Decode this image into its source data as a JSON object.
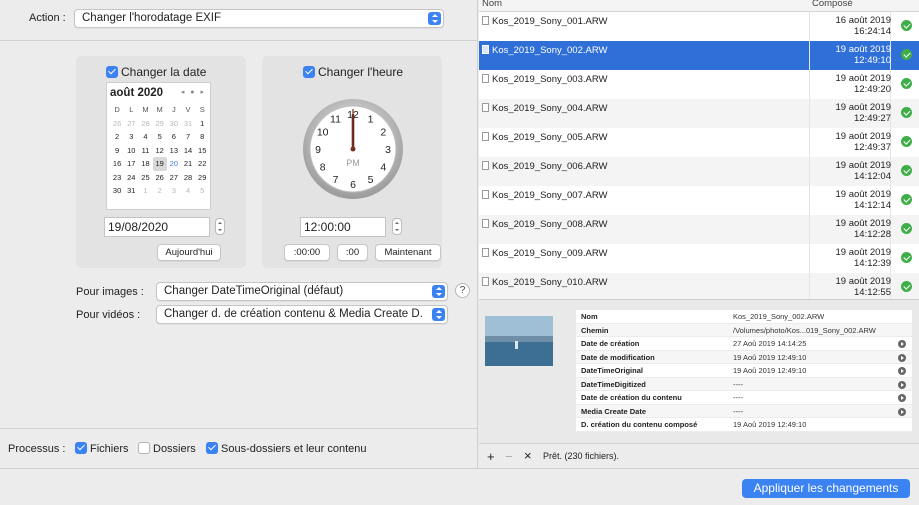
{
  "action": {
    "label": "Action :",
    "value": "Changer l'horodatage EXIF"
  },
  "date_panel": {
    "checkbox_label": "Changer la date",
    "calendar_title": "août 2020",
    "nav": "◂ ● ▸",
    "weekdays": [
      "D",
      "L",
      "M",
      "M",
      "J",
      "V",
      "S"
    ],
    "rows": [
      [
        [
          "26",
          "o"
        ],
        [
          "27",
          "o"
        ],
        [
          "28",
          "o"
        ],
        [
          "29",
          "o"
        ],
        [
          "30",
          "o"
        ],
        [
          "31",
          "o"
        ],
        [
          "1",
          ""
        ]
      ],
      [
        [
          "2",
          ""
        ],
        [
          "3",
          ""
        ],
        [
          "4",
          ""
        ],
        [
          "5",
          ""
        ],
        [
          "6",
          ""
        ],
        [
          "7",
          ""
        ],
        [
          "8",
          ""
        ]
      ],
      [
        [
          "9",
          ""
        ],
        [
          "10",
          ""
        ],
        [
          "11",
          ""
        ],
        [
          "12",
          ""
        ],
        [
          "13",
          ""
        ],
        [
          "14",
          ""
        ],
        [
          "15",
          ""
        ]
      ],
      [
        [
          "16",
          ""
        ],
        [
          "17",
          ""
        ],
        [
          "18",
          ""
        ],
        [
          "19",
          "sel"
        ],
        [
          "20",
          "today"
        ],
        [
          "21",
          ""
        ],
        [
          "22",
          ""
        ]
      ],
      [
        [
          "23",
          ""
        ],
        [
          "24",
          ""
        ],
        [
          "25",
          ""
        ],
        [
          "26",
          ""
        ],
        [
          "27",
          ""
        ],
        [
          "28",
          ""
        ],
        [
          "29",
          ""
        ]
      ],
      [
        [
          "30",
          ""
        ],
        [
          "31",
          ""
        ],
        [
          "1",
          "o"
        ],
        [
          "2",
          "o"
        ],
        [
          "3",
          "o"
        ],
        [
          "4",
          "o"
        ],
        [
          "5",
          "o"
        ]
      ]
    ],
    "date_value": "19/08/2020",
    "today_button": "Aujourd'hui"
  },
  "time_panel": {
    "checkbox_label": "Changer l'heure",
    "clock_numbers": [
      "12",
      "1",
      "2",
      "3",
      "4",
      "5",
      "6",
      "7",
      "8",
      "9",
      "10",
      "11"
    ],
    "clock_period": "PM",
    "time_value": "12:00:00",
    "btn_zero_min": ":00:00",
    "btn_zero_sec": ":00",
    "btn_now": "Maintenant"
  },
  "images": {
    "label": "Pour images :",
    "value": "Changer DateTimeOriginal (défaut)",
    "help": "?"
  },
  "videos": {
    "label": "Pour vidéos :",
    "value": "Changer d. de création contenu & Media Create D."
  },
  "process": {
    "label": "Processus :",
    "files": "Fichiers",
    "folders": "Dossiers",
    "subfolders": "Sous-dossiers et leur contenu"
  },
  "table": {
    "col_name": "Nom",
    "col_composed": "Composé",
    "rows": [
      {
        "name": "Kos_2019_Sony_001.ARW",
        "date": "16 août 2019",
        "time": "16:24:14"
      },
      {
        "name": "Kos_2019_Sony_002.ARW",
        "date": "19 août 2019",
        "time": "12:49:10"
      },
      {
        "name": "Kos_2019_Sony_003.ARW",
        "date": "19 août 2019",
        "time": "12:49:20"
      },
      {
        "name": "Kos_2019_Sony_004.ARW",
        "date": "19 août 2019",
        "time": "12:49:27"
      },
      {
        "name": "Kos_2019_Sony_005.ARW",
        "date": "19 août 2019",
        "time": "12:49:37"
      },
      {
        "name": "Kos_2019_Sony_006.ARW",
        "date": "19 août 2019",
        "time": "14:12:04"
      },
      {
        "name": "Kos_2019_Sony_007.ARW",
        "date": "19 août 2019",
        "time": "14:12:14"
      },
      {
        "name": "Kos_2019_Sony_008.ARW",
        "date": "19 août 2019",
        "time": "14:12:28"
      },
      {
        "name": "Kos_2019_Sony_009.ARW",
        "date": "19 août 2019",
        "time": "14:12:39"
      },
      {
        "name": "Kos_2019_Sony_010.ARW",
        "date": "19 août 2019",
        "time": "14:12:55"
      }
    ]
  },
  "details": [
    {
      "k": "Nom",
      "v": "Kos_2019_Sony_002.ARW"
    },
    {
      "k": "Chemin",
      "v": "/Volumes/photo/Kos...019_Sony_002.ARW"
    },
    {
      "k": "Date de création",
      "v": "27 Aoû 2019 14:14:25"
    },
    {
      "k": "Date de modification",
      "v": "19 Aoû 2019 12:49:10"
    },
    {
      "k": "DateTimeOriginal",
      "v": "19 Aoû 2019 12:49:10"
    },
    {
      "k": "DateTimeDigitized",
      "v": "----"
    },
    {
      "k": "Date de création du contenu",
      "v": "----"
    },
    {
      "k": "Media Create Date",
      "v": "----"
    },
    {
      "k": "D. création du contenu composé",
      "v": "19 Aoû 2019 12:49:10"
    }
  ],
  "bottom": {
    "add": "+",
    "remove": "−",
    "clear": "×",
    "status": "Prêt. (230 fichiers)."
  },
  "apply_label": "Appliquer les changements",
  "colors": {
    "accent": "#3b82f2",
    "selection": "#2f6fd8",
    "ok": "#3fae49"
  }
}
